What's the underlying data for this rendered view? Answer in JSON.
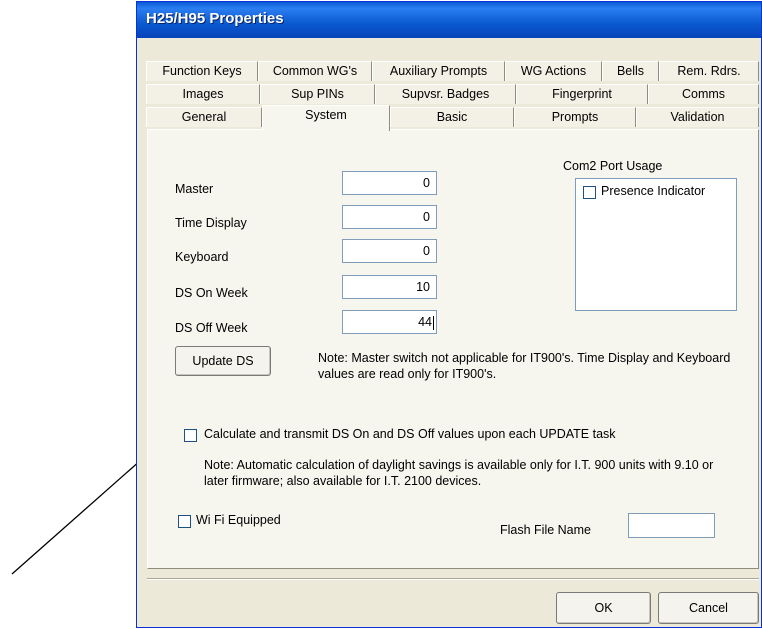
{
  "window": {
    "title": "H25/H95 Properties"
  },
  "tabs": {
    "row1": [
      "Function Keys",
      "Common WG's",
      "Auxiliary Prompts",
      "WG Actions",
      "Bells",
      "Rem. Rdrs."
    ],
    "row2": [
      "Images",
      "Sup PINs",
      "Supvsr. Badges",
      "Fingerprint",
      "Comms"
    ],
    "row3": [
      "General",
      "System",
      "Basic",
      "Prompts",
      "Validation"
    ],
    "active": "System"
  },
  "system": {
    "fields": [
      {
        "label": "Master",
        "value": "0"
      },
      {
        "label": "Time Display",
        "value": "0"
      },
      {
        "label": "Keyboard",
        "value": "0"
      },
      {
        "label": "DS On Week",
        "value": "10"
      },
      {
        "label": "DS Off Week",
        "value": "44"
      }
    ],
    "update_ds_label": "Update DS",
    "master_note": "Note: Master switch not applicable for IT900's.  Time Display and Keyboard values are read only for IT900's.",
    "com2": {
      "title": "Com2 Port Usage",
      "options": [
        {
          "label": "Presence Indicator",
          "checked": false
        }
      ]
    },
    "calc_ds_checkbox": {
      "label": "Calculate and transmit DS On and DS Off values upon each UPDATE task",
      "checked": false
    },
    "calc_note": "Note: Automatic calculation of daylight savings is available only for I.T. 900 units with 9.10 or later firmware; also available for I.T. 2100 devices.",
    "wifi_checkbox": {
      "label": "Wi Fi Equipped",
      "checked": false
    },
    "flash_file": {
      "label": "Flash File Name",
      "value": ""
    }
  },
  "footer": {
    "ok_label": "OK",
    "cancel_label": "Cancel"
  },
  "colors": {
    "titlebar": "#0a59d0",
    "dialog_bg": "#ece9d8",
    "panel_bg": "#f6f5ee",
    "input_border": "#7f9db9"
  }
}
